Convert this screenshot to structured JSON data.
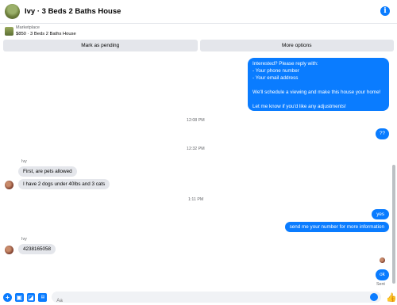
{
  "header": {
    "title": "Ivy · 3 Beds 2 Baths House",
    "info_glyph": "i"
  },
  "listing": {
    "source_label": "Marketplace",
    "summary": "$850 · 3 Beds 2 Baths House"
  },
  "actions": {
    "mark_pending": "Mark as pending",
    "more_options": "More options"
  },
  "thread": {
    "messages": [
      {
        "from": "me",
        "text": "Interested? Please reply with:\n- Your phone number\n- Your email address\n\nWe'll schedule a viewing and make this house your home!\n\nLet me know if you'd like any adjustments!"
      },
      {
        "type": "time",
        "text": "12:08 PM"
      },
      {
        "from": "me",
        "text": "??"
      },
      {
        "type": "time",
        "text": "12:32 PM"
      },
      {
        "type": "sender",
        "text": "Ivy"
      },
      {
        "from": "them",
        "text": "First, are pets allowed"
      },
      {
        "from": "them",
        "text": "I have 2 dogs under 40lbs and 3 cats"
      },
      {
        "type": "time",
        "text": "1:11 PM"
      },
      {
        "from": "me",
        "text": "yes"
      },
      {
        "from": "me",
        "text": "send me your number for more information"
      },
      {
        "type": "sender",
        "text": "Ivy"
      },
      {
        "from": "them",
        "text": "4238165058"
      },
      {
        "from": "me",
        "text": "ok"
      },
      {
        "type": "status",
        "text": "Sent"
      }
    ]
  },
  "composer": {
    "placeholder": "Aa",
    "icons": [
      "plus-icon",
      "photo-icon",
      "sticker-icon",
      "gif-icon",
      "emoji-icon",
      "like-icon"
    ]
  },
  "colors": {
    "accent": "#0a7cff",
    "incoming_bubble": "#e4e6eb",
    "muted_text": "#65676b"
  }
}
